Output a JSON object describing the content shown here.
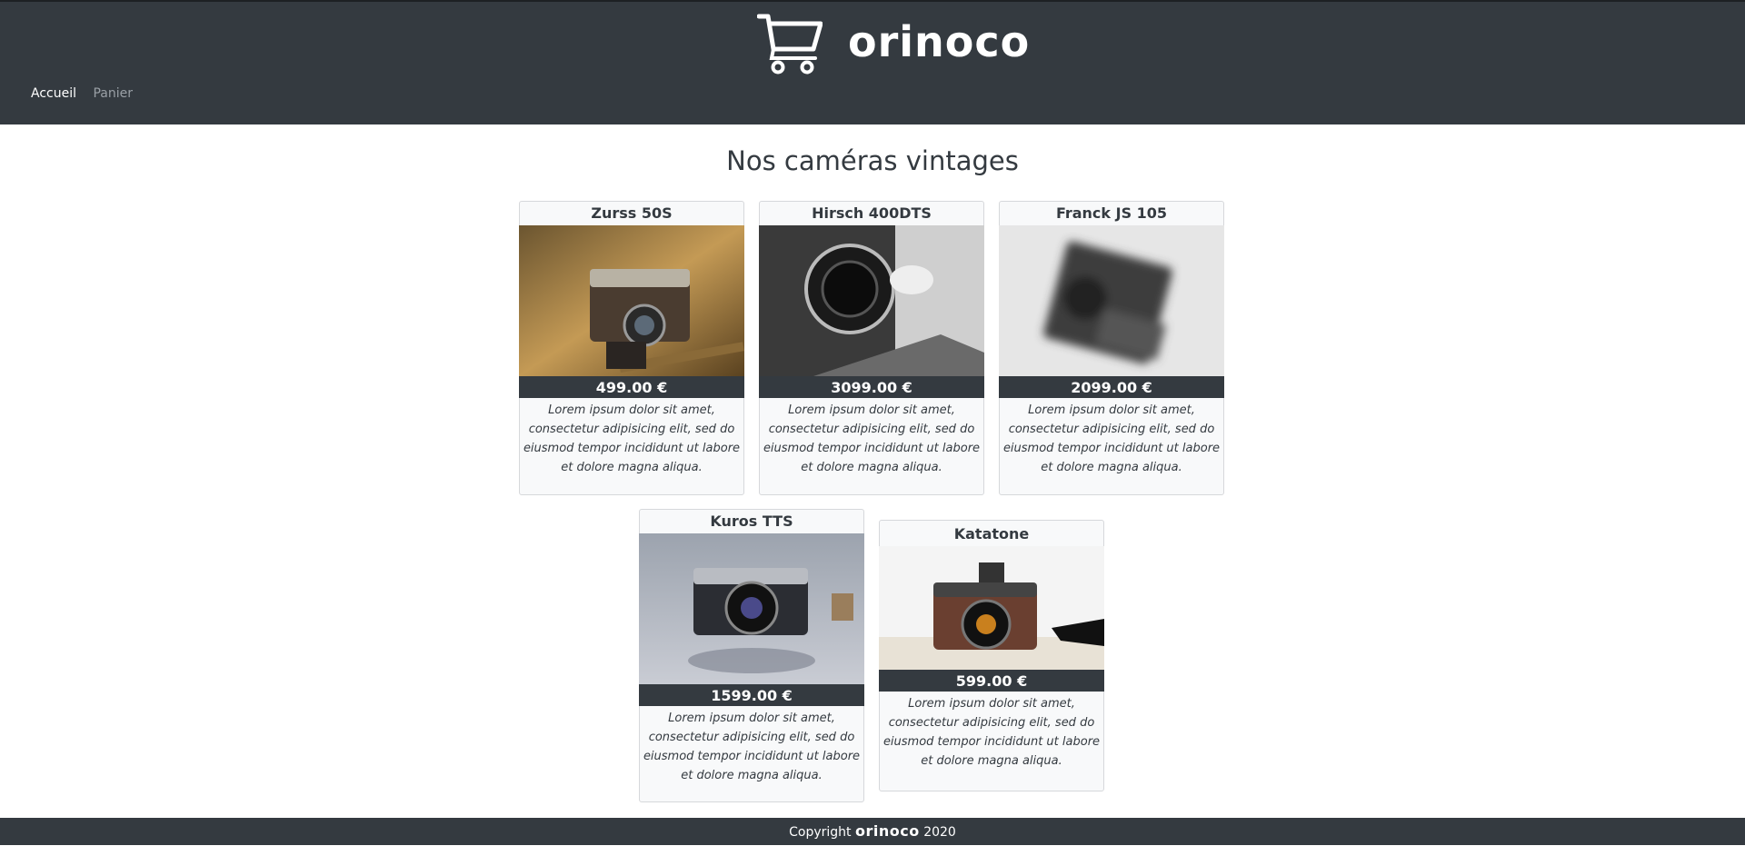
{
  "brand": {
    "name": "orinoco",
    "logo_icon": "shopping-cart-icon"
  },
  "nav": {
    "home": "Accueil",
    "cart": "Panier"
  },
  "main": {
    "title": "Nos caméras vintages"
  },
  "products": [
    {
      "name": "Zurss 50S",
      "price": "499.00 €",
      "description": "Lorem ipsum dolor sit amet, consectetur adipisicing elit, sed do eiusmod tempor incididunt ut labore et dolore magna aliqua."
    },
    {
      "name": "Hirsch 400DTS",
      "price": "3099.00 €",
      "description": "Lorem ipsum dolor sit amet, consectetur adipisicing elit, sed do eiusmod tempor incididunt ut labore et dolore magna aliqua."
    },
    {
      "name": "Franck JS 105",
      "price": "2099.00 €",
      "description": "Lorem ipsum dolor sit amet, consectetur adipisicing elit, sed do eiusmod tempor incididunt ut labore et dolore magna aliqua."
    },
    {
      "name": "Kuros TTS",
      "price": "1599.00 €",
      "description": "Lorem ipsum dolor sit amet, consectetur adipisicing elit, sed do eiusmod tempor incididunt ut labore et dolore magna aliqua."
    },
    {
      "name": "Katatone",
      "price": "599.00 €",
      "description": "Lorem ipsum dolor sit amet, consectetur adipisicing elit, sed do eiusmod tempor incididunt ut labore et dolore magna aliqua."
    }
  ],
  "footer": {
    "prefix": "Copyright",
    "brand": "orinoco",
    "year": "2020"
  },
  "colors": {
    "dark": "#343a40",
    "card_bg": "#f8f9fa",
    "white": "#ffffff"
  }
}
